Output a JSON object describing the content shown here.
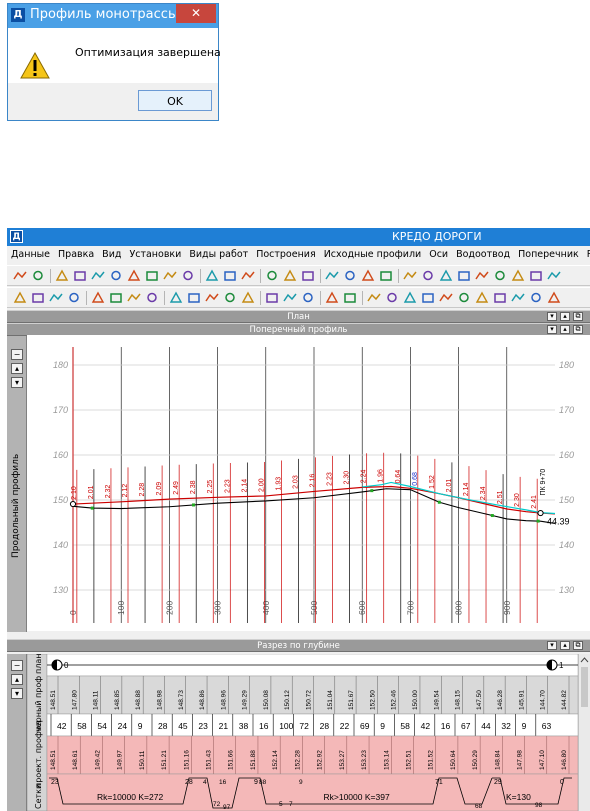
{
  "dialog": {
    "app_icon": "Д",
    "title": "Профиль монотрассы",
    "close": "✕",
    "message": "Оптимизация завершена",
    "ok_label": "OK"
  },
  "window": {
    "app_icon": "Д",
    "title": "КРЕДО ДОРОГИ",
    "menu": [
      "Данные",
      "Правка",
      "Вид",
      "Установки",
      "Виды работ",
      "Построения",
      "Исходные профили",
      "Оси",
      "Водоотвод",
      "Поперечник",
      "Ра"
    ],
    "panels": {
      "plan": "План",
      "cross_profile": "Поперечный профиль",
      "depth_section": "Разрез по глубине"
    },
    "panel_controls": [
      "▾",
      "▴",
      "⧉"
    ],
    "side_labels": {
      "long_profile": "Продольный профиль",
      "plan": "план",
      "black_profile": "черный проф",
      "grids": "Сетки",
      "design_profile": "проект. профил"
    }
  },
  "chart_data": {
    "type": "line",
    "ylabel": "Продольный профиль",
    "y_ticks": [
      130,
      140,
      150,
      160,
      170,
      180
    ],
    "ylim": [
      124,
      184
    ],
    "x_ticks": [
      "0",
      "100",
      "200",
      "300",
      "400",
      "500",
      "600",
      "700",
      "800",
      "900"
    ],
    "xlim": [
      0,
      1000
    ],
    "grid": true,
    "series": [
      {
        "color": "#000000",
        "x": [
          0,
          40,
          100,
          200,
          300,
          400,
          500,
          600,
          650,
          700,
          760,
          800,
          860,
          900,
          940,
          970,
          1000
        ],
        "values": [
          148.6,
          148.2,
          148.1,
          148.5,
          149.3,
          149.8,
          150.5,
          151.8,
          152.5,
          152.3,
          149.5,
          148.3,
          146.8,
          145.8,
          145.4,
          145.3,
          144.8
        ]
      },
      {
        "color": "#cc0000",
        "x": [
          0,
          100,
          200,
          300,
          400,
          500,
          600,
          660,
          700,
          760,
          800,
          860,
          900,
          940,
          970,
          1000
        ],
        "values": [
          149.1,
          149.6,
          150.2,
          150.6,
          150.9,
          151.9,
          152.8,
          153.0,
          152.6,
          151.4,
          150.5,
          149.0,
          148.0,
          147.4,
          147.1,
          146.9
        ]
      },
      {
        "color": "#00cccc",
        "x": [
          600,
          640,
          660,
          700,
          760,
          820,
          880,
          940,
          970,
          1000
        ],
        "values": [
          152.9,
          153.4,
          153.9,
          153.0,
          151.4,
          150.1,
          148.9,
          147.8,
          147.2,
          147.0
        ]
      }
    ],
    "labels": [
      "2.10",
      "2.01",
      "2.32",
      "2.12",
      "2.28",
      "2.09",
      "2.49",
      "2.38",
      "2.25",
      "2.23",
      "2.14",
      "2.00",
      "1.93",
      "2.03",
      "2.16",
      "2.23",
      "2.30",
      "2.24",
      "1.96",
      "0.64",
      "0.68",
      "1.52",
      "2.01",
      "2.14",
      "2.34",
      "2.51",
      "2.30",
      "2.41"
    ],
    "annotations": [
      "44.39",
      "ПК 9+70"
    ]
  },
  "depth_grid": {
    "plan_marks": [
      "0",
      "1"
    ],
    "black_elev": [
      "148.51",
      "147.80",
      "148.11",
      "148.85",
      "148.88",
      "148.98",
      "148.73",
      "148.86",
      "148.96",
      "149.29",
      "150.08",
      "150.12",
      "150.72",
      "151.04",
      "151.67",
      "152.50",
      "152.46",
      "150.00",
      "149.54",
      "148.15",
      "147.50",
      "146.28",
      "145.91",
      "144.70",
      "144.82"
    ],
    "distances": [
      "42",
      "58",
      "54",
      "24",
      "9",
      "28",
      "45",
      "23",
      "21",
      "38",
      "16",
      "100",
      "72",
      "28",
      "22",
      "69",
      "9",
      "58",
      "42",
      "16",
      "67",
      "44",
      "32",
      "9",
      "63"
    ],
    "design_elev": [
      "148.51",
      "148.61",
      "149.42",
      "149.97",
      "150.11",
      "151.21",
      "151.16",
      "151.43",
      "151.66",
      "151.88",
      "152.14",
      "152.28",
      "152.92",
      "153.27",
      "153.23",
      "153.14",
      "152.51",
      "151.52",
      "150.64",
      "150.29",
      "148.84",
      "147.98",
      "147.10",
      "146.80"
    ],
    "curves": [
      {
        "left": "23",
        "right": "28",
        "text": "Rk=10000  K=272"
      },
      {
        "left": "9",
        "right": "71",
        "text": "Rk>10000  K=397"
      },
      {
        "left": "29",
        "right": "0",
        "text": "K=130"
      }
    ],
    "small_marks": [
      "4",
      "16",
      "88",
      "9",
      "72",
      "97",
      "5",
      "7",
      "68",
      "98"
    ]
  },
  "colors": {
    "title_blue": "#1f7fd6",
    "dialog_title": "#4aa0e6",
    "panel_gray": "#9a9a9a",
    "grid_pink": "#f4b8b8",
    "ground_line": "#000000",
    "design_line": "#cc0000",
    "cyan_line": "#00cccc"
  }
}
